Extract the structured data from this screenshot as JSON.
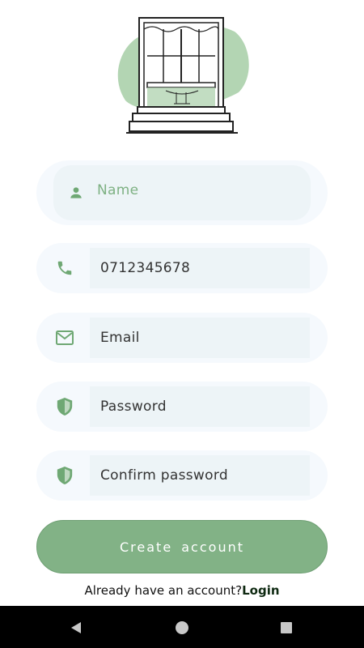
{
  "illustration": {
    "icon": "window-illustration"
  },
  "form": {
    "name": {
      "placeholder": "Name",
      "icon": "person-icon"
    },
    "phone": {
      "value": "0712345678",
      "icon": "phone-icon"
    },
    "email": {
      "placeholder": "Email",
      "icon": "mail-icon"
    },
    "password": {
      "placeholder": "Password",
      "icon": "shield-icon"
    },
    "confirm_password": {
      "placeholder": "Confirm password",
      "icon": "shield-icon"
    }
  },
  "create_button": {
    "label": "Create  account"
  },
  "login_prompt": {
    "text": "Already have an account?",
    "link": "Login"
  },
  "colors": {
    "accent": "#82b286",
    "field_bg": "#edf4f7",
    "outer_bg": "#f5f9fd",
    "navbar": "#000000"
  },
  "navbar": {
    "back": "back-icon",
    "home": "home-icon",
    "recents": "recents-icon"
  }
}
